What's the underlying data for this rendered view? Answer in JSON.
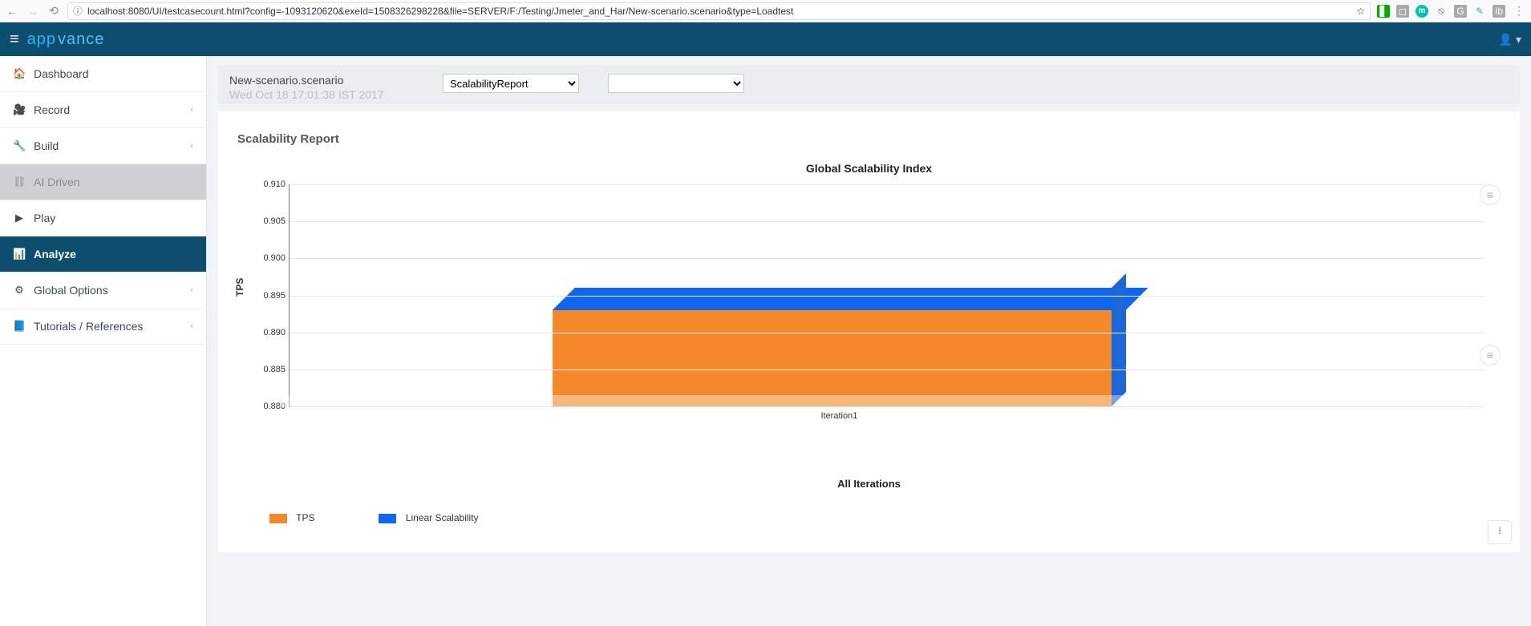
{
  "browser": {
    "url": "localhost:8080/UI/testcasecount.html?config=-1093120620&exeId=1508326298228&file=SERVER/F:/Testing/Jmeter_and_Har/New-scenario.scenario&type=Loadtest"
  },
  "header": {
    "brand_a": "app",
    "brand_b": "vance"
  },
  "sidebar": {
    "items": [
      {
        "icon": "dashboard-icon",
        "glyph": "📊",
        "label": "Dashboard",
        "expandable": false
      },
      {
        "icon": "record-icon",
        "glyph": "📹",
        "label": "Record",
        "expandable": true
      },
      {
        "icon": "build-icon",
        "glyph": "🔧",
        "label": "Build",
        "expandable": true
      },
      {
        "icon": "ai-icon",
        "glyph": "⛓",
        "label": "AI Driven",
        "expandable": false,
        "disabled": true
      },
      {
        "icon": "play-icon",
        "glyph": "▶",
        "label": "Play",
        "expandable": false
      },
      {
        "icon": "analyze-icon",
        "glyph": "📶",
        "label": "Analyze",
        "expandable": false,
        "active": true
      },
      {
        "icon": "options-icon",
        "glyph": "⚙⚙",
        "label": "Global Options",
        "expandable": true
      },
      {
        "icon": "tutorials-icon",
        "glyph": "📘",
        "label": "Tutorials / References",
        "expandable": true
      }
    ]
  },
  "toolbar": {
    "title": "New-scenario.scenario",
    "timestamp": "Wed Oct 18 17:01:38 IST 2017",
    "report_select": "ScalabilityReport",
    "secondary_select": ""
  },
  "report": {
    "title": "Scalability Report"
  },
  "chart_data": {
    "type": "bar",
    "title": "Global Scalability Index",
    "xlabel": "All Iterations",
    "ylabel": "TPS",
    "ylim": [
      0.88,
      0.91
    ],
    "yticks": [
      0.88,
      0.885,
      0.89,
      0.895,
      0.9,
      0.905,
      0.91
    ],
    "categories": [
      "Iteration1"
    ],
    "series": [
      {
        "name": "TPS",
        "color": "#f4892c",
        "values": [
          0.893
        ]
      },
      {
        "name": "Linear Scalability",
        "color": "#1166f0",
        "values": [
          0.896
        ]
      }
    ]
  }
}
